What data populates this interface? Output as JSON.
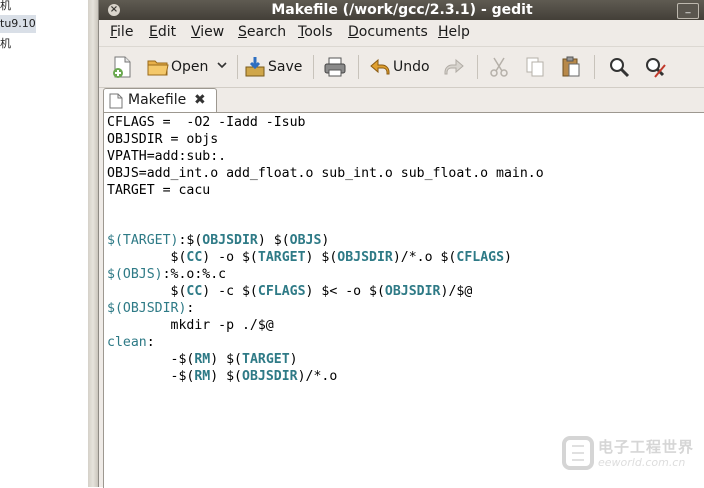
{
  "left_pane": {
    "items": [
      "机",
      "tu9.10",
      "机"
    ]
  },
  "window": {
    "title": "Makefile (/work/gcc/2.3.1) - gedit",
    "close_glyph": "×",
    "minimize_glyph": "_"
  },
  "menubar": {
    "items": [
      {
        "first": "F",
        "rest": "ile"
      },
      {
        "first": "E",
        "rest": "dit"
      },
      {
        "first": "V",
        "rest": "iew"
      },
      {
        "first": "S",
        "rest": "earch"
      },
      {
        "first": "T",
        "rest": "ools"
      },
      {
        "first": "D",
        "rest": "ocuments"
      },
      {
        "first": "H",
        "rest": "elp"
      }
    ]
  },
  "toolbar": {
    "open_label": "Open",
    "save_label": "Save",
    "undo_label": "Undo"
  },
  "tab": {
    "label": "Makefile",
    "close_glyph": "✖"
  },
  "editor": {
    "lines": [
      "CFLAGS =  -O2 -Iadd -Isub",
      "OBJSDIR = objs",
      "VPATH=add:sub:.",
      "OBJS=add_int.o add_float.o sub_int.o sub_float.o main.o",
      "TARGET = cacu",
      "",
      "",
      "$(TARGET):$(OBJSDIR) $(OBJS)",
      "        $(CC) -o $(TARGET) $(OBJSDIR)/*.o $(CFLAGS)",
      "$(OBJS):%.o:%.c",
      "        $(CC) -c $(CFLAGS) $< -o $(OBJSDIR)/$@",
      "$(OBJSDIR):",
      "        mkdir -p ./$@",
      "clean:",
      "        -$(RM) $(TARGET)",
      "        -$(RM) $(OBJSDIR)/*.o"
    ]
  },
  "watermark": {
    "text_cn": "电子工程世界",
    "text_url": "eeworld.com.cn"
  },
  "colors": {
    "syntax_var": "#2e7a86",
    "titlebar": "#4a463f",
    "window_bg": "#efebe7"
  }
}
